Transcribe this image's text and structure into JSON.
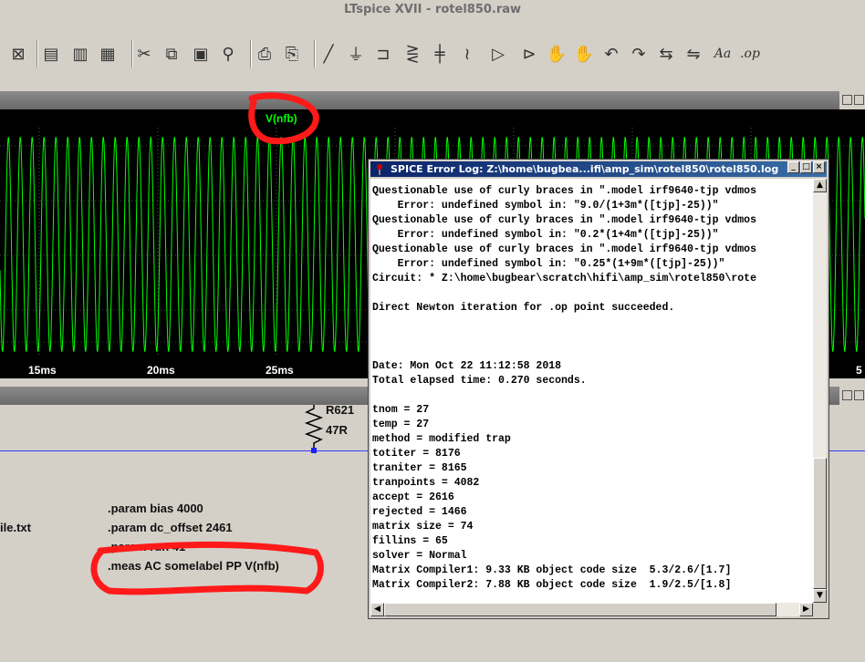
{
  "window": {
    "title": "LTspice XVII - rotel850.raw"
  },
  "toolbar": {
    "icons": [
      "pick-visible-traces-icon",
      "tile-vertically-icon",
      "tile-horizontally-icon",
      "cascade-windows-icon",
      "cut-icon",
      "copy-icon",
      "paste-icon",
      "find-icon",
      "print-preview-icon",
      "print-icon",
      "draw-wire-icon",
      "ground-icon",
      "label-net-icon",
      "resistor-icon",
      "capacitor-icon",
      "inductor-icon",
      "diode-icon",
      "component-icon",
      "move-icon",
      "drag-icon",
      "undo-icon",
      "redo-icon",
      "rotate-icon",
      "mirror-icon",
      "text-icon",
      "spice-directive-icon"
    ]
  },
  "waveform": {
    "trace_label": "V(nfb)",
    "trace_color": "#00ff00",
    "background": "#000000",
    "x_ticks": [
      {
        "label": "15ms",
        "value": 15
      },
      {
        "label": "20ms",
        "value": 20
      },
      {
        "label": "25ms",
        "value": 25
      },
      {
        "label": "5",
        "value": 50
      }
    ]
  },
  "schematic": {
    "resistor_name": "R621",
    "resistor_value": "47R",
    "left_text": "ile.txt",
    "directives": [
      ".param bias 4000",
      ".param dc_offset 2461",
      ".param run 41",
      ".meas AC somelabel PP V(nfb)"
    ]
  },
  "error_log": {
    "title": "SPICE Error Log: Z:\\home\\bugbea...ifi\\amp_sim\\rotel850\\rotel850.log",
    "lines": [
      "Questionable use of curly braces in \".model irf9640-tjp vdmos",
      "    Error: undefined symbol in: \"9.0/(1+3m*([tjp]-25))\"",
      "Questionable use of curly braces in \".model irf9640-tjp vdmos",
      "    Error: undefined symbol in: \"0.2*(1+4m*([tjp]-25))\"",
      "Questionable use of curly braces in \".model irf9640-tjp vdmos",
      "    Error: undefined symbol in: \"0.25*(1+9m*([tjp]-25))\"",
      "Circuit: * Z:\\home\\bugbear\\scratch\\hifi\\amp_sim\\rotel850\\rote",
      "",
      "Direct Newton iteration for .op point succeeded.",
      "",
      "",
      "",
      "Date: Mon Oct 22 11:12:58 2018",
      "Total elapsed time: 0.270 seconds.",
      "",
      "tnom = 27",
      "temp = 27",
      "method = modified trap",
      "totiter = 8176",
      "traniter = 8165",
      "tranpoints = 4082",
      "accept = 2616",
      "rejected = 1466",
      "matrix size = 74",
      "fillins = 65",
      "solver = Normal",
      "Matrix Compiler1: 9.33 KB object code size  5.3/2.6/[1.7]",
      "Matrix Compiler2: 7.88 KB object code size  1.9/2.5/[1.8]"
    ]
  },
  "annotation_color": "#ff0000"
}
